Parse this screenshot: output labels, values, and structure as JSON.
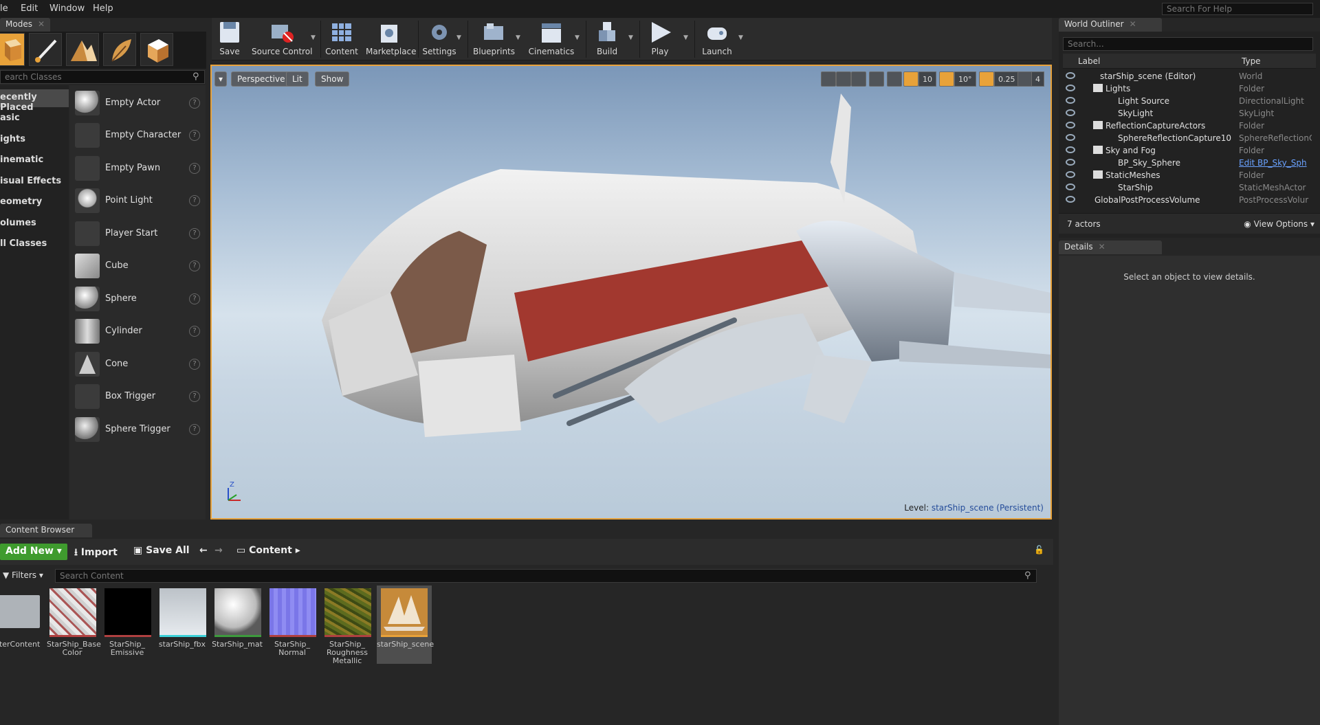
{
  "menu": [
    "le",
    "Edit",
    "Window",
    "Help"
  ],
  "help_search_placeholder": "Search For Help",
  "modes": {
    "tab": "Modes",
    "search_placeholder": "earch Classes",
    "categories": [
      "ecently Placed",
      "asic",
      "ights",
      "inematic",
      "isual Effects",
      "eometry",
      "olumes",
      "ll Classes"
    ],
    "items": [
      "Empty Actor",
      "Empty Character",
      "Empty Pawn",
      "Point Light",
      "Player Start",
      "Cube",
      "Sphere",
      "Cylinder",
      "Cone",
      "Box Trigger",
      "Sphere Trigger"
    ]
  },
  "toolbar": [
    "Save",
    "Source Control",
    "Content",
    "Marketplace",
    "Settings",
    "Blueprints",
    "Cinematics",
    "Build",
    "Play",
    "Launch"
  ],
  "viewport": {
    "perspective": "Perspective",
    "lit": "Lit",
    "show": "Show",
    "grid_snap": "10",
    "rot_snap": "10°",
    "scale_snap": "0.25",
    "cam_speed": "4",
    "level_label": "Level:",
    "level_name": "starShip_scene (Persistent)",
    "axis_z": "Z"
  },
  "outliner": {
    "tab": "World Outliner",
    "search_placeholder": "Search...",
    "col_label": "Label",
    "col_type": "Type",
    "rows": [
      {
        "label": "starShip_scene (Editor)",
        "type": "World"
      },
      {
        "label": "Lights",
        "type": "Folder"
      },
      {
        "label": "Light Source",
        "type": "DirectionalLight"
      },
      {
        "label": "SkyLight",
        "type": "SkyLight"
      },
      {
        "label": "ReflectionCaptureActors",
        "type": "Folder"
      },
      {
        "label": "SphereReflectionCapture10",
        "type": "SphereReflectionC"
      },
      {
        "label": "Sky and Fog",
        "type": "Folder"
      },
      {
        "label": "BP_Sky_Sphere",
        "type": "Edit BP_Sky_Sph"
      },
      {
        "label": "StaticMeshes",
        "type": "Folder"
      },
      {
        "label": "StarShip",
        "type": "StaticMeshActor"
      },
      {
        "label": "GlobalPostProcessVolume",
        "type": "PostProcessVolur"
      }
    ],
    "actor_count": "7 actors",
    "view_options": "View Options"
  },
  "details": {
    "tab": "Details",
    "empty_msg": "Select an object to view details."
  },
  "content_browser": {
    "tab": "Content Browser",
    "add_new": "Add New",
    "import": "Import",
    "save_all": "Save All",
    "path": "Content",
    "filters": "Filters",
    "search_placeholder": "Search Content",
    "assets": [
      {
        "name": "arterContent",
        "bar": "#00000000"
      },
      {
        "name": "StarShip_Base\nColor",
        "bar": "#b04040"
      },
      {
        "name": "StarShip_\nEmissive",
        "bar": "#b04040"
      },
      {
        "name": "starShip_fbx",
        "bar": "#3bd0d8"
      },
      {
        "name": "StarShip_mat",
        "bar": "#3d9a3d"
      },
      {
        "name": "StarShip_\nNormal",
        "bar": "#b04040"
      },
      {
        "name": "StarShip_\nRoughness\nMetallic",
        "bar": "#b04040"
      },
      {
        "name": "starShip_scene",
        "bar": "#e8a23a"
      }
    ]
  },
  "colors": {
    "accent": "#e8a23a",
    "green": "#3f9b2e",
    "link": "#6aa2ff"
  }
}
